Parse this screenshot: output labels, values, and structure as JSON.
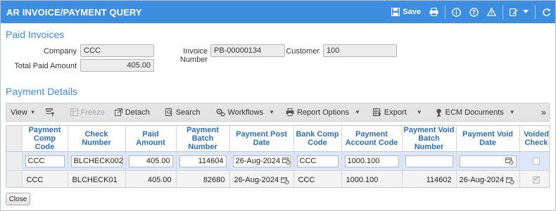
{
  "titlebar": {
    "title": "AR INVOICE/PAYMENT QUERY",
    "save_label": "Save"
  },
  "paid_invoices": {
    "section_title": "Paid Invoices",
    "company_label": "Company",
    "company_value": "CCC",
    "invoice_number_label": "Invoice Number",
    "invoice_number_value": "PB-00000134",
    "customer_label": "Customer",
    "customer_value": "100",
    "total_paid_label": "Total Paid Amount",
    "total_paid_value": "405.00"
  },
  "payment_details": {
    "section_title": "Payment Details"
  },
  "toolbar": {
    "view": "View",
    "freeze": "Freeze",
    "detach": "Detach",
    "search": "Search",
    "workflows": "Workflows",
    "report_options": "Report Options",
    "export": "Export",
    "ecm_documents": "ECM Documents",
    "more": "»"
  },
  "grid": {
    "headers": [
      "Payment Comp Code",
      "Check Number",
      "Paid Amount",
      "Payment Batch Number",
      "Payment Post Date",
      "Bank Comp Code",
      "Payment Account Code",
      "Payment Void Batch Number",
      "Payment Void Date",
      "Voided Check"
    ],
    "rows": [
      {
        "comp_code": "CCC",
        "check_number": "BLCHECK002",
        "paid_amount": "405.00",
        "batch_number": "114604",
        "post_date": "26-Aug-2024",
        "bank_comp_code": "CCC",
        "account_code": "1000.100",
        "void_batch": "",
        "void_date": "",
        "voided": false
      },
      {
        "comp_code": "CCC",
        "check_number": "BLCHECK01",
        "paid_amount": "405.00",
        "batch_number": "82680",
        "post_date": "26-Aug-2024",
        "bank_comp_code": "CCC",
        "account_code": "1000.100",
        "void_batch": "114602",
        "void_date": "26-Aug-2024",
        "voided": true
      }
    ]
  },
  "footer": {
    "close_label": "Close"
  },
  "colors": {
    "titlebar": "#3d8ee0",
    "header_text": "#2a6fbd",
    "selected_row": "#dce8f7"
  }
}
